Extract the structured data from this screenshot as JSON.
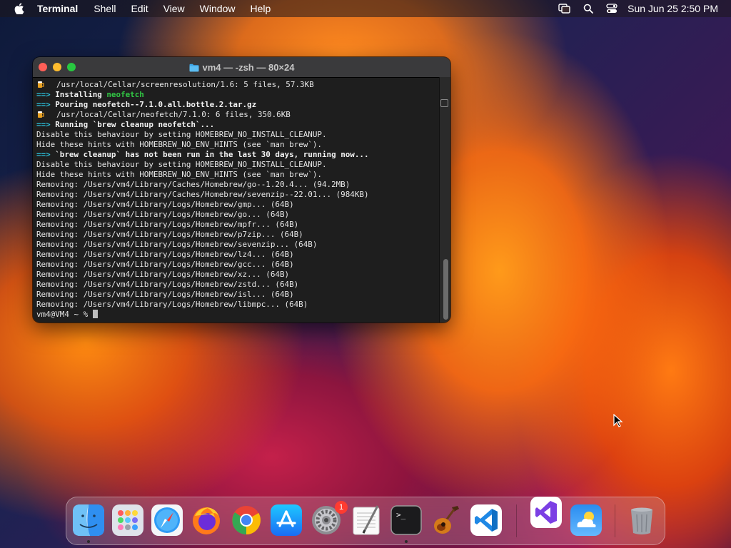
{
  "menubar": {
    "app_name": "Terminal",
    "items": [
      "Shell",
      "Edit",
      "View",
      "Window",
      "Help"
    ],
    "clock": "Sun Jun 25  2:50 PM"
  },
  "terminal": {
    "title": "vm4 — -zsh — 80×24",
    "lines": [
      {
        "beer": true,
        "parts": [
          {
            "t": "/usr/local/Cellar/screenresolution/1.6: 5 files, 57.3KB",
            "c": ""
          }
        ]
      },
      {
        "parts": [
          {
            "t": "==> ",
            "c": "arrow"
          },
          {
            "t": "Installing ",
            "c": "b"
          },
          {
            "t": "neofetch",
            "c": "green"
          }
        ]
      },
      {
        "parts": [
          {
            "t": "==> ",
            "c": "arrow"
          },
          {
            "t": "Pouring neofetch--7.1.0.all.bottle.2.tar.gz",
            "c": "b"
          }
        ]
      },
      {
        "beer": true,
        "parts": [
          {
            "t": "/usr/local/Cellar/neofetch/7.1.0: 6 files, 350.6KB",
            "c": ""
          }
        ]
      },
      {
        "parts": [
          {
            "t": "==> ",
            "c": "arrow"
          },
          {
            "t": "Running `brew cleanup neofetch`...",
            "c": "b"
          }
        ]
      },
      {
        "parts": [
          {
            "t": "Disable this behaviour by setting HOMEBREW_NO_INSTALL_CLEANUP.",
            "c": ""
          }
        ]
      },
      {
        "parts": [
          {
            "t": "Hide these hints with HOMEBREW_NO_ENV_HINTS (see `man brew`).",
            "c": ""
          }
        ]
      },
      {
        "parts": [
          {
            "t": "==> ",
            "c": "arrow"
          },
          {
            "t": "`brew cleanup` has not been run in the last 30 days, running now...",
            "c": "b"
          }
        ]
      },
      {
        "parts": [
          {
            "t": "Disable this behaviour by setting HOMEBREW_NO_INSTALL_CLEANUP.",
            "c": ""
          }
        ]
      },
      {
        "parts": [
          {
            "t": "Hide these hints with HOMEBREW_NO_ENV_HINTS (see `man brew`).",
            "c": ""
          }
        ]
      },
      {
        "parts": [
          {
            "t": "Removing: /Users/vm4/Library/Caches/Homebrew/go--1.20.4... (94.2MB)",
            "c": ""
          }
        ]
      },
      {
        "parts": [
          {
            "t": "Removing: /Users/vm4/Library/Caches/Homebrew/sevenzip--22.01... (984KB)",
            "c": ""
          }
        ]
      },
      {
        "parts": [
          {
            "t": "Removing: /Users/vm4/Library/Logs/Homebrew/gmp... (64B)",
            "c": ""
          }
        ]
      },
      {
        "parts": [
          {
            "t": "Removing: /Users/vm4/Library/Logs/Homebrew/go... (64B)",
            "c": ""
          }
        ]
      },
      {
        "parts": [
          {
            "t": "Removing: /Users/vm4/Library/Logs/Homebrew/mpfr... (64B)",
            "c": ""
          }
        ]
      },
      {
        "parts": [
          {
            "t": "Removing: /Users/vm4/Library/Logs/Homebrew/p7zip... (64B)",
            "c": ""
          }
        ]
      },
      {
        "parts": [
          {
            "t": "Removing: /Users/vm4/Library/Logs/Homebrew/sevenzip... (64B)",
            "c": ""
          }
        ]
      },
      {
        "parts": [
          {
            "t": "Removing: /Users/vm4/Library/Logs/Homebrew/lz4... (64B)",
            "c": ""
          }
        ]
      },
      {
        "parts": [
          {
            "t": "Removing: /Users/vm4/Library/Logs/Homebrew/gcc... (64B)",
            "c": ""
          }
        ]
      },
      {
        "parts": [
          {
            "t": "Removing: /Users/vm4/Library/Logs/Homebrew/xz... (64B)",
            "c": ""
          }
        ]
      },
      {
        "parts": [
          {
            "t": "Removing: /Users/vm4/Library/Logs/Homebrew/zstd... (64B)",
            "c": ""
          }
        ]
      },
      {
        "parts": [
          {
            "t": "Removing: /Users/vm4/Library/Logs/Homebrew/isl... (64B)",
            "c": ""
          }
        ]
      },
      {
        "parts": [
          {
            "t": "Removing: /Users/vm4/Library/Logs/Homebrew/libmpc... (64B)",
            "c": ""
          }
        ]
      },
      {
        "parts": [
          {
            "t": "vm4@VM4 ~ % ",
            "c": ""
          }
        ],
        "cursor": true
      }
    ]
  },
  "dock": {
    "apps": [
      {
        "name": "finder-icon",
        "running": true
      },
      {
        "name": "launchpad-icon",
        "running": false
      },
      {
        "name": "safari-icon",
        "running": false
      },
      {
        "name": "firefox-icon",
        "running": false
      },
      {
        "name": "chrome-icon",
        "running": false
      },
      {
        "name": "app-store-icon",
        "running": false
      },
      {
        "name": "system-settings-icon",
        "running": false,
        "badge": "1"
      },
      {
        "name": "textedit-icon",
        "running": false
      },
      {
        "name": "terminal-icon",
        "running": true
      },
      {
        "name": "garageband-icon",
        "running": false
      },
      {
        "name": "vscode-icon",
        "running": false
      },
      {
        "name": "visual-studio-icon",
        "running": false
      },
      {
        "name": "weather-icon",
        "running": false
      },
      {
        "name": "trash-icon",
        "running": false
      }
    ]
  }
}
